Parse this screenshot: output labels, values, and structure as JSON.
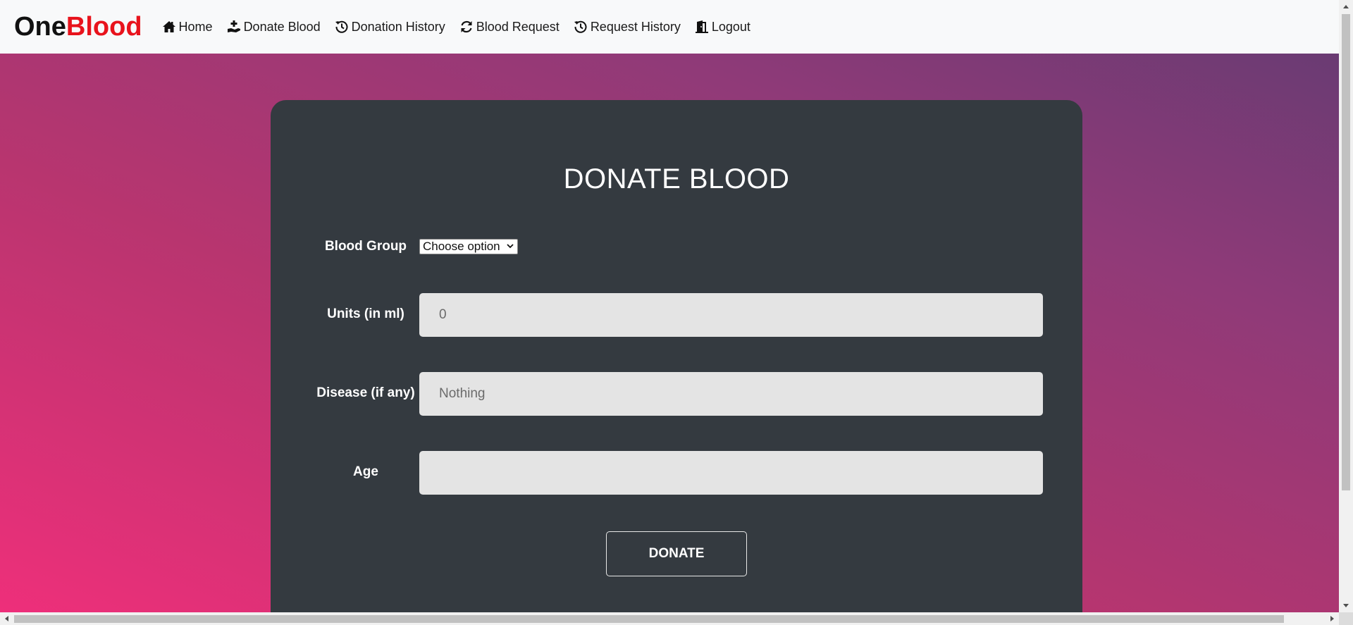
{
  "brand": {
    "part1": "One",
    "part2": "Blood"
  },
  "nav": {
    "items": [
      {
        "label": "Home",
        "icon": "home-icon"
      },
      {
        "label": "Donate Blood",
        "icon": "hand-holding-icon"
      },
      {
        "label": "Donation History",
        "icon": "history-icon"
      },
      {
        "label": "Blood Request",
        "icon": "refresh-icon"
      },
      {
        "label": "Request History",
        "icon": "history-icon"
      },
      {
        "label": "Logout",
        "icon": "door-exit-icon"
      }
    ]
  },
  "form": {
    "title": "DONATE BLOOD",
    "blood_group": {
      "label": "Blood Group",
      "value": "Choose option"
    },
    "units": {
      "label": "Units (in ml)",
      "value": "0"
    },
    "disease": {
      "label": "Disease (if any)",
      "placeholder": "Nothing"
    },
    "age": {
      "label": "Age",
      "value": ""
    },
    "submit_label": "DONATE"
  },
  "colors": {
    "brand_red": "#e8131c",
    "card_bg": "#343a40",
    "input_bg": "#e4e4e4",
    "gradient_start": "#ee2f7a",
    "gradient_end": "#6a3b73"
  }
}
